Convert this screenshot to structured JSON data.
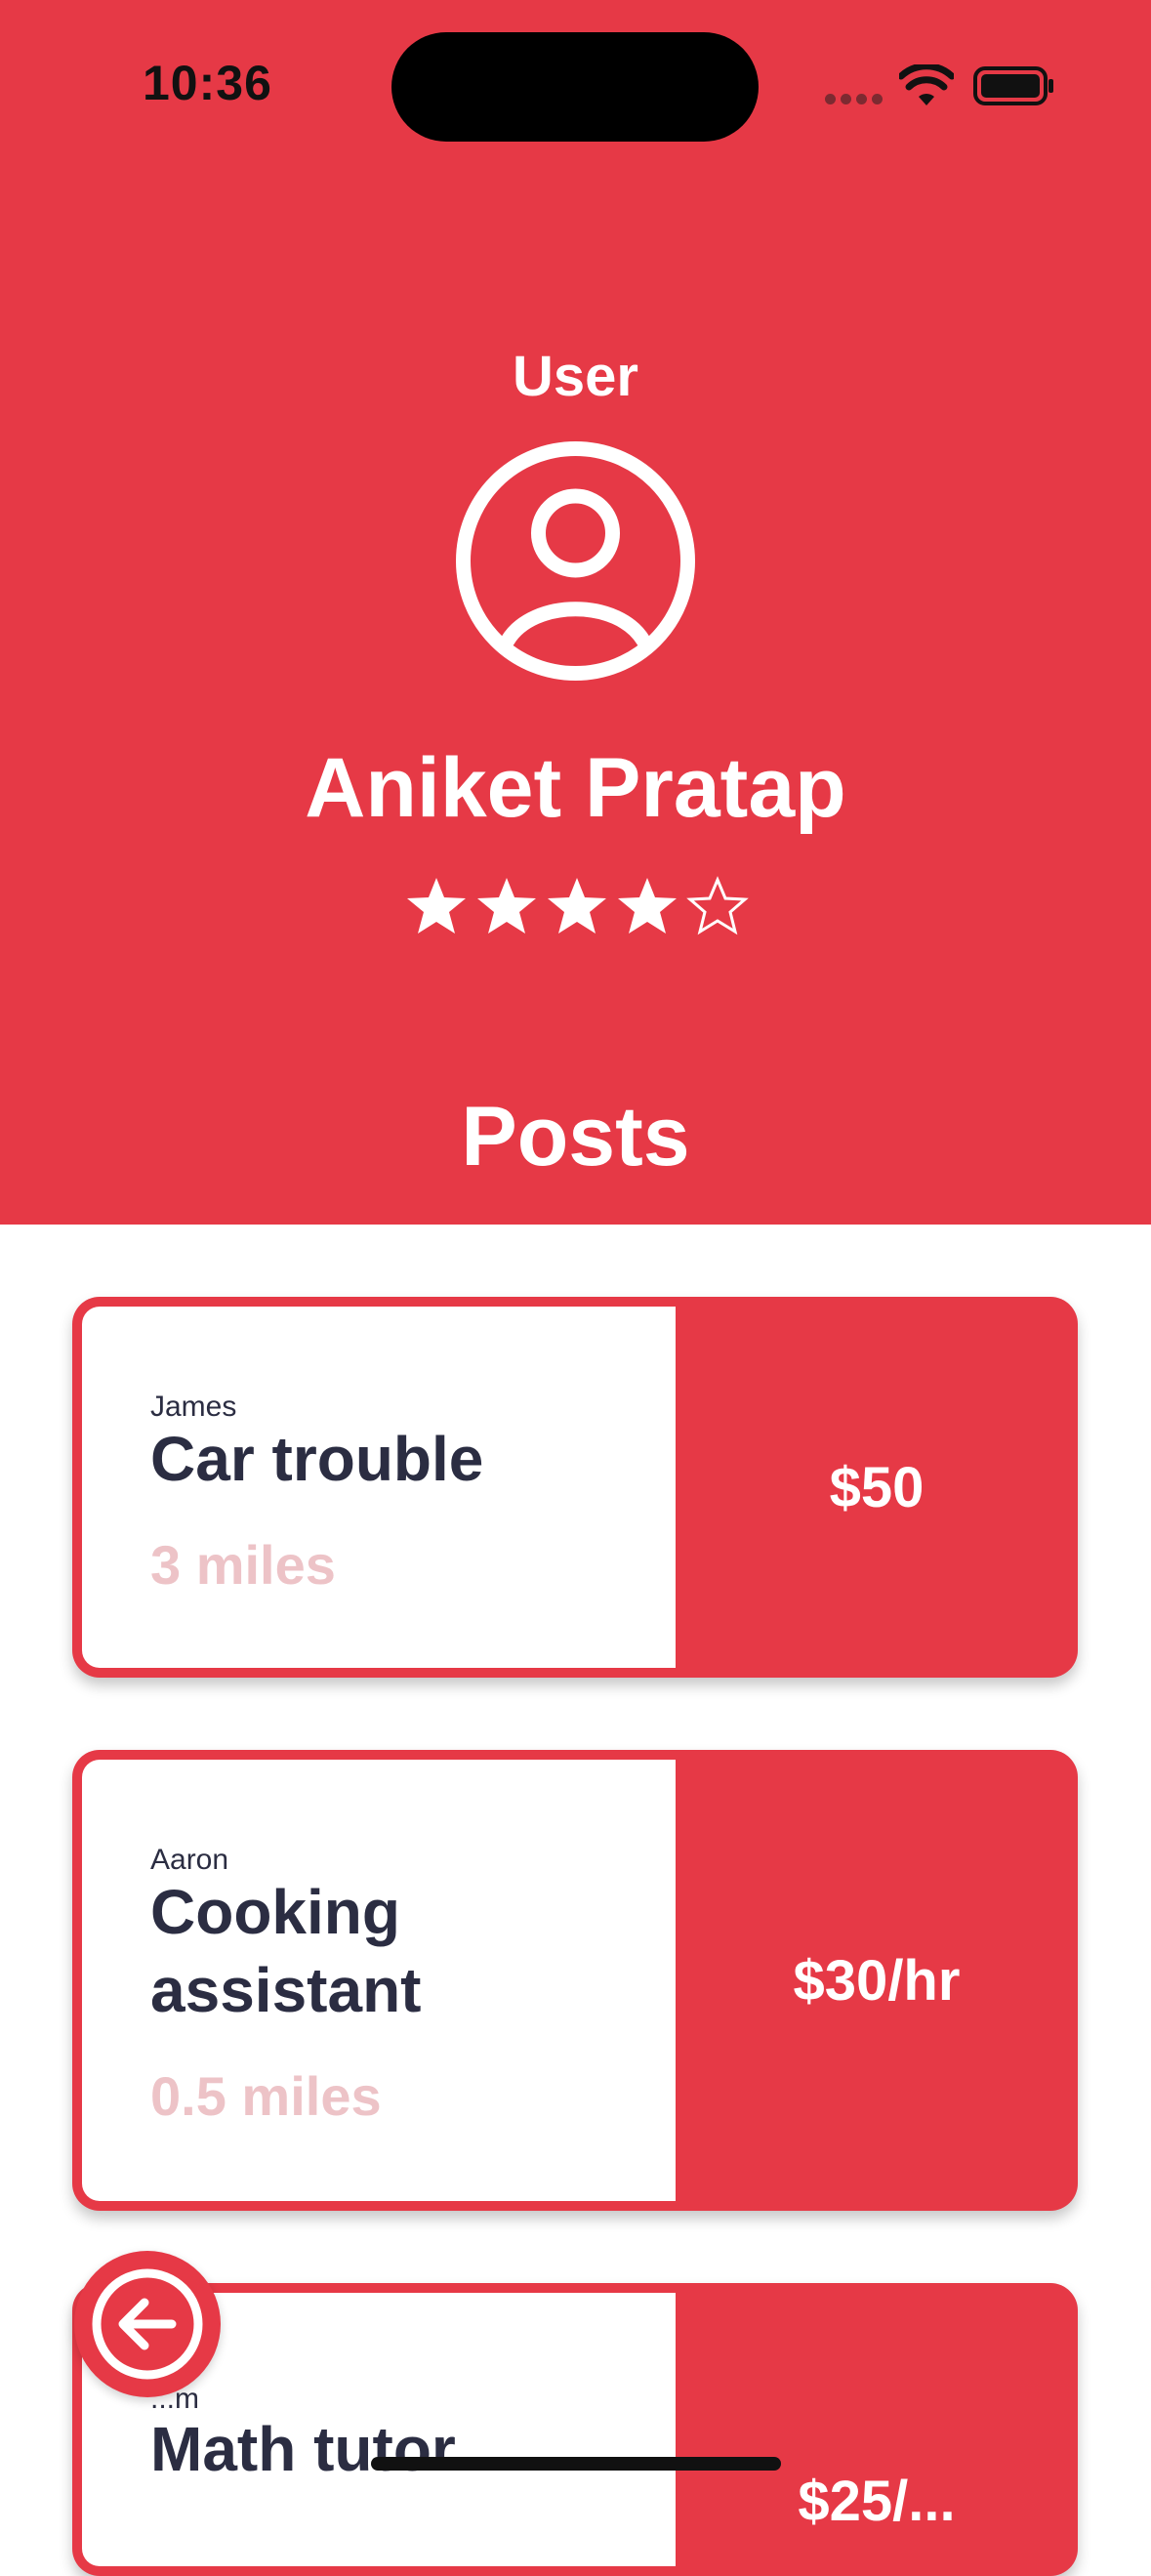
{
  "status_bar": {
    "time": "10:36"
  },
  "profile": {
    "label": "User",
    "name": "Aniket Pratap",
    "rating": 4,
    "rating_max": 5,
    "avatar_icon": "user-circle-icon"
  },
  "posts_section": {
    "title": "Posts"
  },
  "posts": [
    {
      "author": "James",
      "title": "Car trouble",
      "distance": "3 miles",
      "price": "$50"
    },
    {
      "author": "Aaron",
      "title": "Cooking assistant",
      "distance": "0.5 miles",
      "price": "$30/hr"
    },
    {
      "author": "...m",
      "title": "Math tutor",
      "distance": "",
      "price": "$25/..."
    }
  ],
  "back_button": {
    "icon": "arrow-left-icon"
  },
  "colors": {
    "primary": "#e63946",
    "text_dark": "#2b2d42",
    "distance_text": "#edc3c7",
    "white": "#ffffff"
  }
}
